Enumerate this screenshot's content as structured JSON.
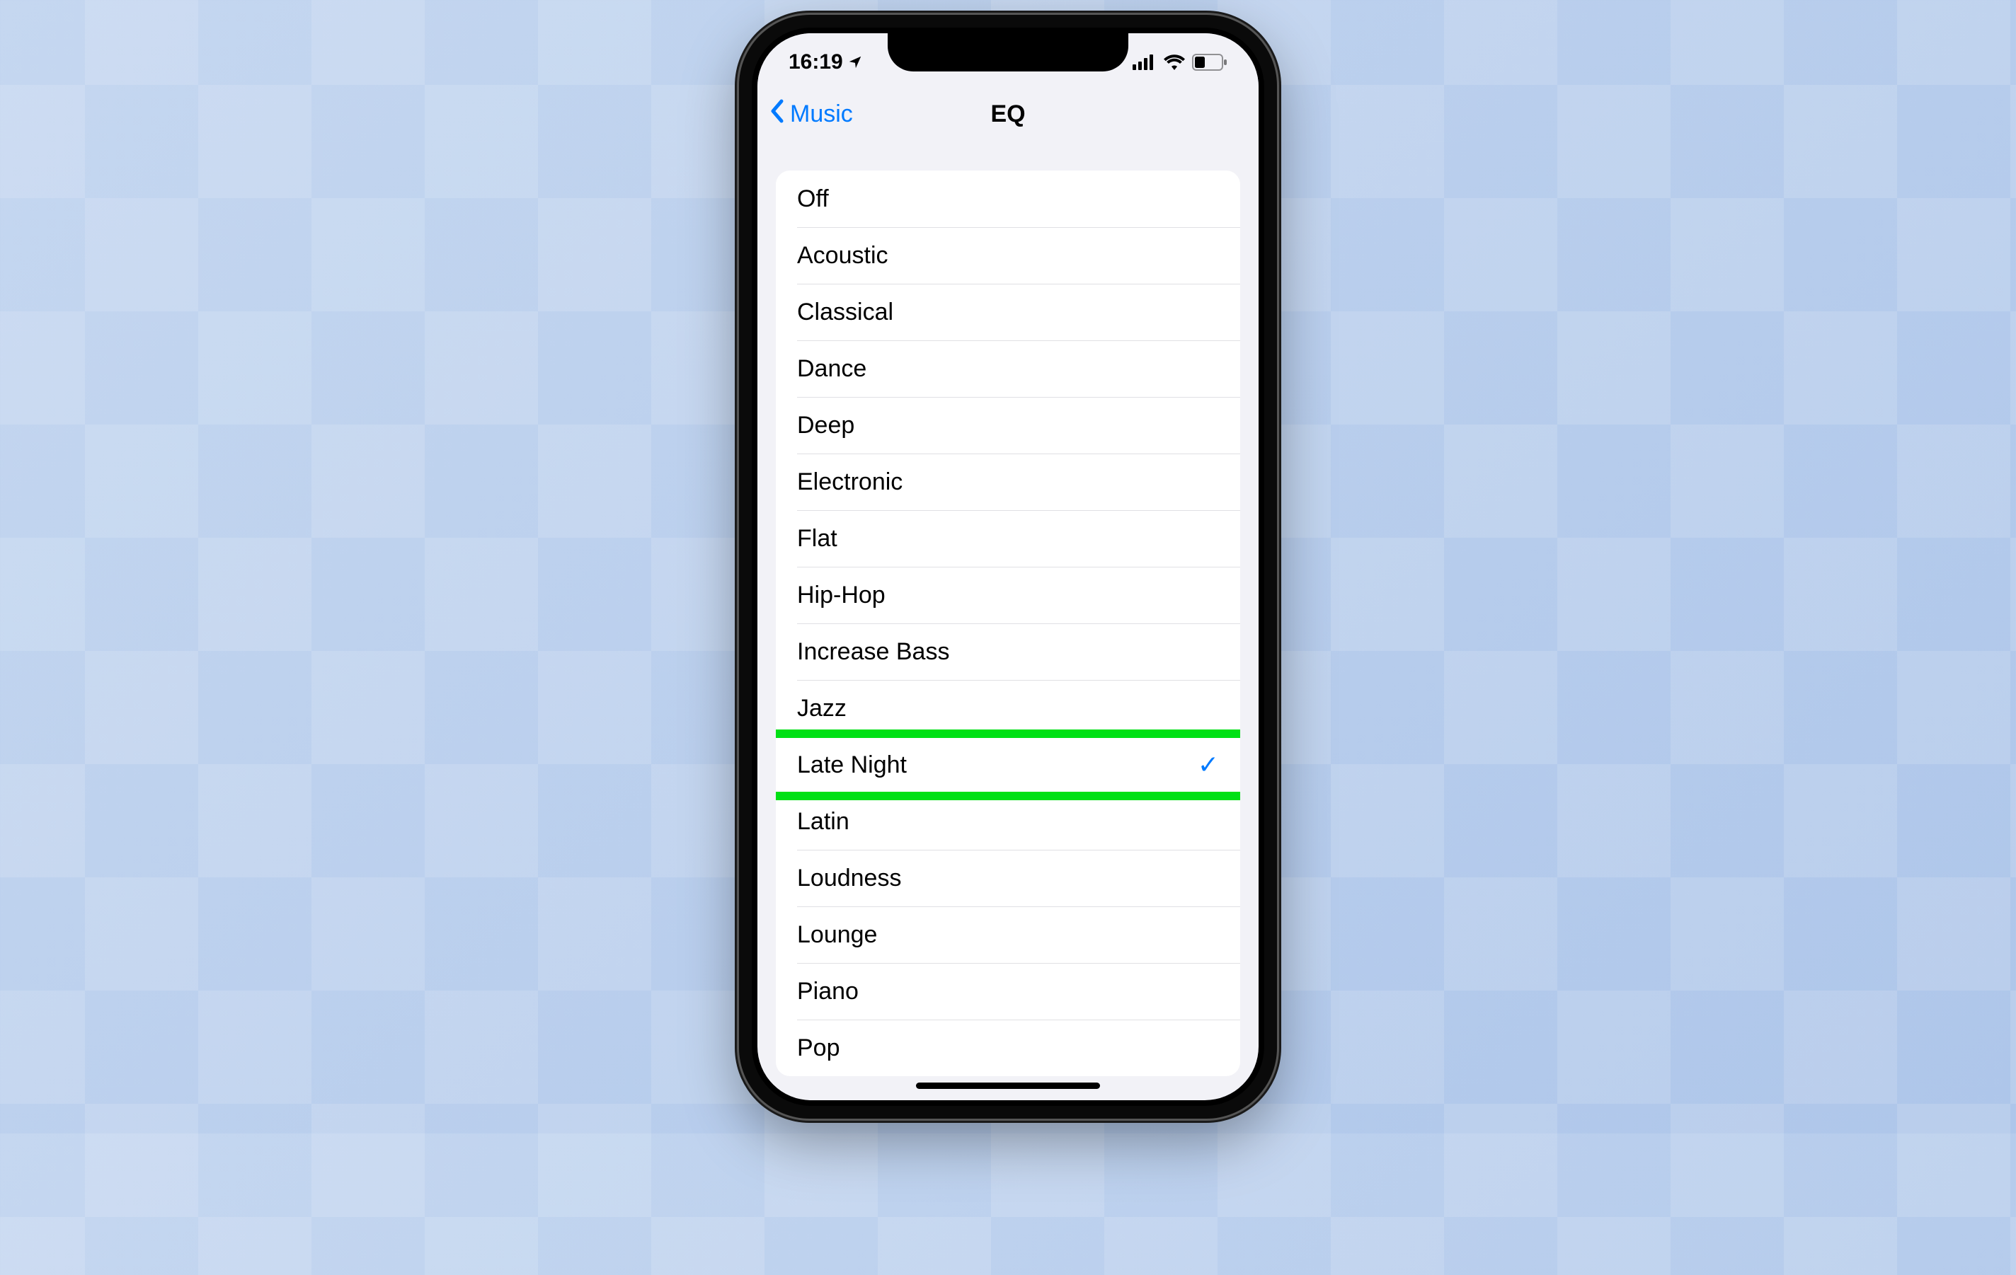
{
  "status": {
    "time": "16:19",
    "location_active": true,
    "cell_signal": 4,
    "wifi": true,
    "battery_low": true
  },
  "nav": {
    "back_label": "Music",
    "title": "EQ"
  },
  "eq": {
    "selected_index": 10,
    "options": [
      "Off",
      "Acoustic",
      "Classical",
      "Dance",
      "Deep",
      "Electronic",
      "Flat",
      "Hip-Hop",
      "Increase Bass",
      "Jazz",
      "Late Night",
      "Latin",
      "Loudness",
      "Lounge",
      "Piano",
      "Pop"
    ],
    "highlighted_index": 10
  },
  "colors": {
    "tint": "#007aff",
    "highlight_box": "#00e015",
    "background": "#f2f2f7"
  },
  "checkmark_glyph": "✓"
}
